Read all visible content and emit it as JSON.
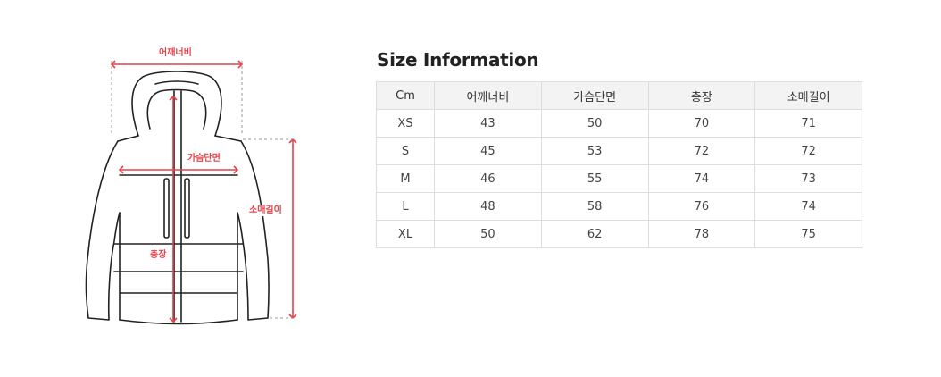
{
  "diagram": {
    "labels": {
      "shoulder": "어깨너비",
      "chest": "가슴단면",
      "sleeve": "소매길이",
      "length": "총장"
    }
  },
  "size_info": {
    "title": "Size Information",
    "columns": [
      "Cm",
      "어깨너비",
      "가슴단면",
      "총장",
      "소매길이"
    ],
    "rows": [
      [
        "XS",
        "43",
        "50",
        "70",
        "71"
      ],
      [
        "S",
        "45",
        "53",
        "72",
        "72"
      ],
      [
        "M",
        "46",
        "55",
        "74",
        "73"
      ],
      [
        "L",
        "48",
        "58",
        "76",
        "74"
      ],
      [
        "XL",
        "50",
        "62",
        "78",
        "75"
      ]
    ]
  },
  "colors": {
    "accent": "#e8414a",
    "outline": "#222222",
    "header_bg": "#f3f3f3",
    "border": "#dddddd"
  }
}
